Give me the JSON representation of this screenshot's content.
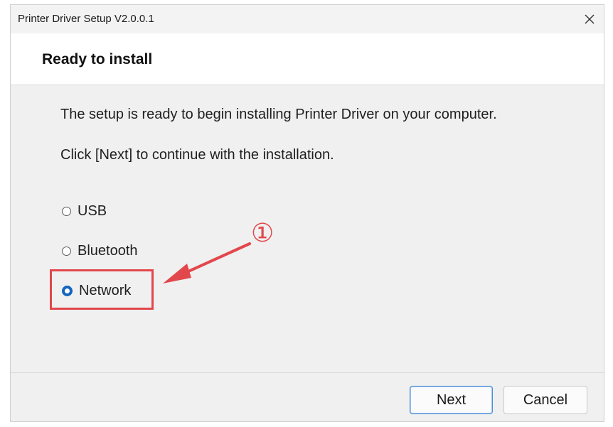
{
  "window": {
    "title": "Printer Driver Setup V2.0.0.1",
    "close_icon": "close-icon"
  },
  "header": {
    "heading": "Ready to install"
  },
  "content": {
    "line1": "The setup is ready to begin installing Printer Driver on your computer.",
    "line2": "Click [Next] to continue with the installation."
  },
  "connection_options": [
    {
      "label": "USB",
      "selected": false
    },
    {
      "label": "Bluetooth",
      "selected": false
    },
    {
      "label": "Network",
      "selected": true
    }
  ],
  "annotation": {
    "marker": "①",
    "color": "#e2474c"
  },
  "buttons": {
    "next": "Next",
    "cancel": "Cancel"
  },
  "colors": {
    "accent": "#1565c0",
    "annotation_red": "#e2474c"
  }
}
